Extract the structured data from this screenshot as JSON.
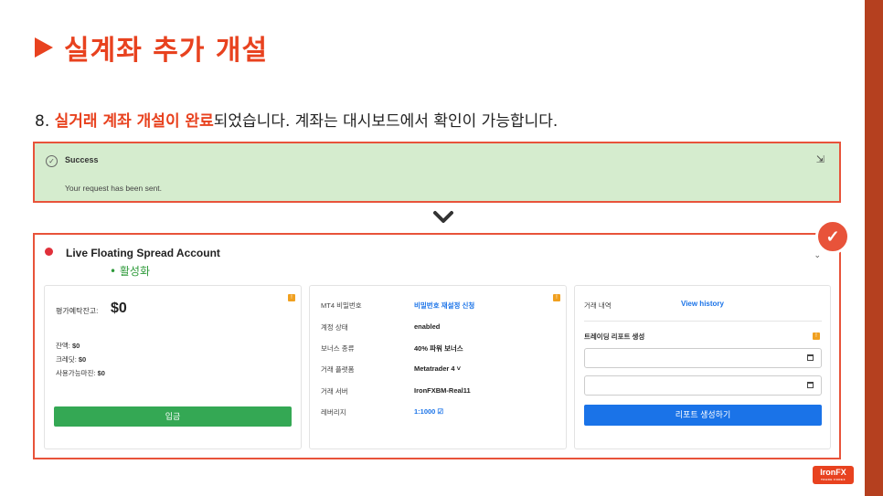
{
  "title": "실계좌 추가 개설",
  "step": {
    "prefix": "8. ",
    "highlight": "실거래 계좌 개설이 완료",
    "suffix": "되었습니다. 계좌는 대시보드에서 확인이 가능합니다."
  },
  "success": {
    "title": "Success",
    "message": "Your request has been sent."
  },
  "account": {
    "name": "Live Floating Spread Account",
    "status": "• 활성화",
    "balance": {
      "label": "평가예탁잔고:",
      "value": "$0",
      "rows": [
        {
          "label": "잔액:",
          "value": "$0"
        },
        {
          "label": "크레딧:",
          "value": "$0"
        },
        {
          "label": "사용가능마진:",
          "value": "$0"
        }
      ],
      "deposit_label": "입금"
    },
    "details": [
      {
        "label": "MT4 비밀번호",
        "value": "비밀번호 재설정 신청",
        "link": true
      },
      {
        "label": "계정 상태",
        "value": "enabled",
        "link": false
      },
      {
        "label": "보너스 종류",
        "value": "40% 파워 보너스",
        "link": false
      },
      {
        "label": "거래 플랫폼",
        "value": "Metatrader 4 ˅",
        "link": false
      },
      {
        "label": "거래 서버",
        "value": "IronFXBM-Real11",
        "link": false
      },
      {
        "label": "레버리지",
        "value": "1:1000 ☑",
        "link": true
      }
    ],
    "history": {
      "label": "거래 내역",
      "link": "View history",
      "report_label": "트레이딩 리포트 생성",
      "button": "리포트 생성하기"
    }
  },
  "logo": {
    "text": "IronFX",
    "tagline": "TRADE FOREX"
  },
  "colors": {
    "accent": "#e8421f",
    "success_bg": "#d5ecce",
    "deposit": "#34a854",
    "primary": "#1a73e8"
  }
}
